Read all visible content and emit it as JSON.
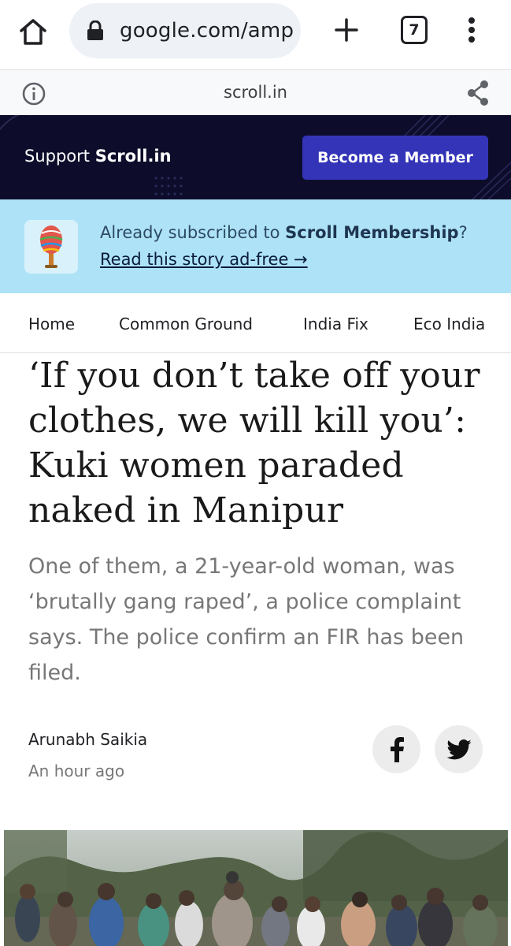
{
  "browser": {
    "url": "google.com/amp",
    "tab_count": "7",
    "icons": {
      "home": "home-icon",
      "lock": "lock-icon",
      "new_tab": "plus-icon",
      "menu": "more-vert-icon"
    }
  },
  "amp_bar": {
    "domain": "scroll.in",
    "icons": {
      "info": "info-icon",
      "share": "share-icon"
    }
  },
  "support_banner": {
    "text_prefix": "Support ",
    "brand": "Scroll.in",
    "button_label": "Become a Member",
    "colors": {
      "background": "#0d0d2b",
      "button": "#3434b8"
    }
  },
  "membership_promo": {
    "text_prefix": "Already subscribed to ",
    "membership_name": "Scroll Membership",
    "text_suffix": "?",
    "link_text": "Read this story ad-free →",
    "icon": "microphone-icon",
    "colors": {
      "background": "#aee3f7"
    }
  },
  "nav": {
    "items": [
      "Home",
      "Common Ground",
      "India Fix",
      "Eco India"
    ]
  },
  "article": {
    "headline": "‘If you don’t take off your clothes, we will kill you’: Kuki women paraded naked in Manipur",
    "standfirst": "One of them, a 21-year-old woman, was ‘brutally gang raped’, a police complaint says. The police confirm an FIR has been filed.",
    "author": "Arunabh Saikia",
    "published": "An hour ago",
    "share_icons": [
      "facebook-icon",
      "twitter-icon"
    ]
  }
}
